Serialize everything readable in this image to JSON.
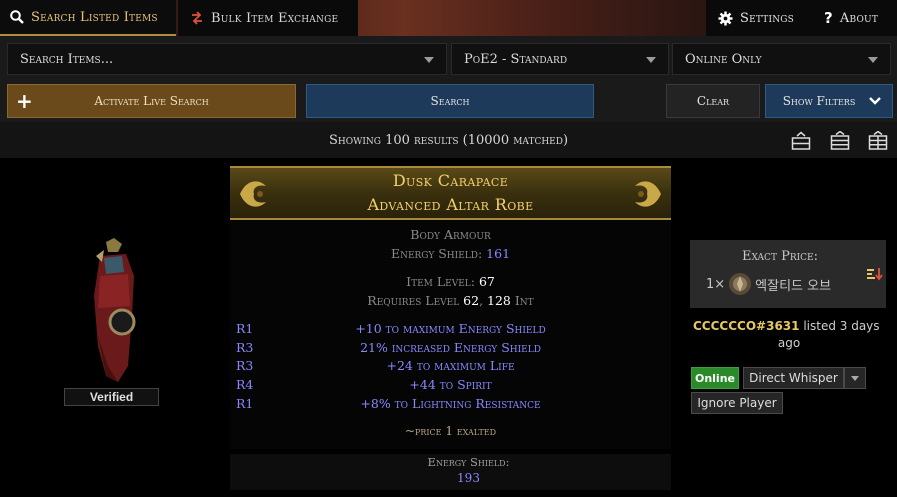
{
  "nav": {
    "search_tab": "Search Listed Items",
    "bulk_tab": "Bulk Item Exchange",
    "settings": "Settings",
    "about": "About"
  },
  "search": {
    "query_placeholder": "Search Items...",
    "league": "PoE2 - Standard",
    "status_filter": "Online Only",
    "live_button": "Activate Live Search",
    "search_button": "Search",
    "clear_button": "Clear",
    "filters_button": "Show Filters"
  },
  "results": {
    "summary": "Showing 100 results (10000 matched)"
  },
  "item": {
    "name": "Dusk Carapace",
    "base": "Advanced Altar Robe",
    "category": "Body Armour",
    "energy_shield_label": "Energy Shield: ",
    "energy_shield_value": "161",
    "item_level_label": "Item Level: ",
    "item_level_value": "67",
    "requires_label": "Requires Level ",
    "requires_level": "62",
    "requires_sep": ", ",
    "requires_int": "128",
    "requires_int_label": " Int",
    "mods": [
      {
        "tier": "R1",
        "text": "+10 to maximum Energy Shield"
      },
      {
        "tier": "R3",
        "text": "21% increased Energy Shield"
      },
      {
        "tier": "R3",
        "text": "+24 to maximum Life"
      },
      {
        "tier": "R4",
        "text": "+44 to Spirit"
      },
      {
        "tier": "R1",
        "text": "+8% to Lightning Resistance"
      }
    ],
    "note": "~price 1 exalted",
    "verified": "Verified",
    "extra_label": "Energy Shield:",
    "extra_value": "193"
  },
  "listing": {
    "price_label": "Exact Price:",
    "amount": "1×",
    "currency": "엑잘티드 오브",
    "account": "CCCCCCO#3631",
    "listed": " listed 3 days",
    "ago": "ago",
    "online": "Online",
    "whisper": "Direct Whisper",
    "ignore": "Ignore Player"
  },
  "colors": {
    "accent_gold": "#e4c57a",
    "unique_name": "#f2d26a",
    "magic_mod": "#8888ff",
    "online_green": "#2a8a2a",
    "search_blue": "#1d3a5a"
  },
  "icons": [
    "search-icon",
    "exchange-icon",
    "gear-icon",
    "question-icon",
    "plus-icon",
    "chevron-down-icon",
    "list-layout-icon",
    "grid-layout-icon",
    "detail-layout-icon",
    "exalted-orb-icon",
    "sort-icon"
  ]
}
